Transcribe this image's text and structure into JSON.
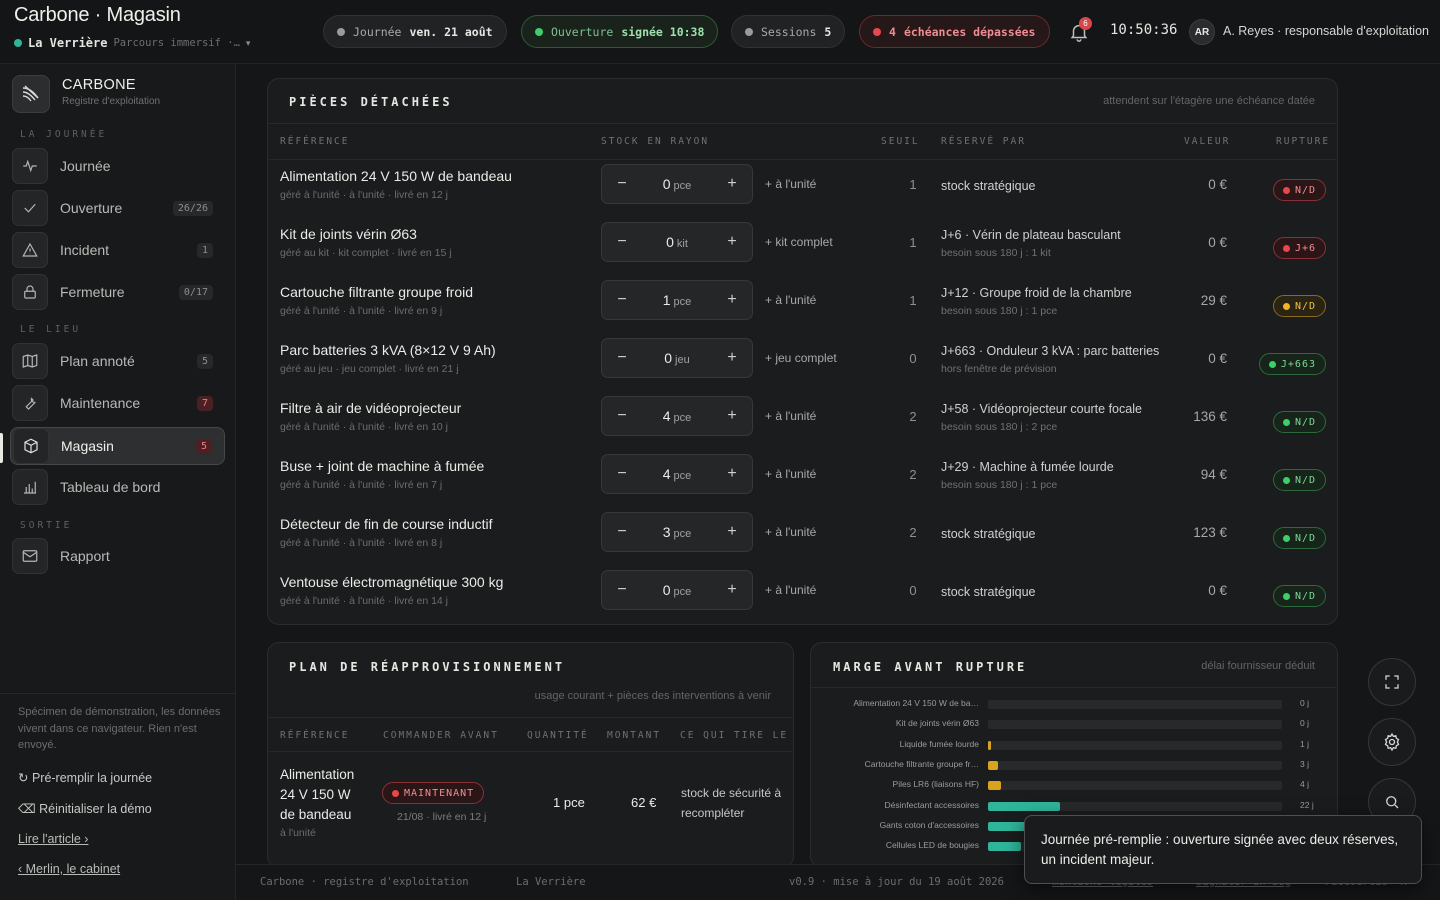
{
  "header": {
    "title": "Carbone · Magasin",
    "venue": "La Verrière",
    "mode": "Parcours immersif ·…",
    "day_label": "Journée",
    "day_value": "ven. 21 août",
    "open_label": "Ouverture",
    "open_value": "signée 10:38",
    "sessions_label": "Sessions",
    "sessions_value": "5",
    "due_count": "4",
    "due_label": "échéances dépassées",
    "notifications": "6",
    "clock": "10:50:36",
    "user_initials": "AR",
    "user_name": "A. Reyes · responsable d'exploitation",
    "colors": {
      "ok": "#3ecf6a",
      "alert": "#e5484d",
      "warn": "#f0b429",
      "accent": "#2fb59a"
    }
  },
  "sidebar": {
    "brand": "CARBONE",
    "brand_sub": "Registre d'exploitation",
    "sections": [
      "LA JOURNÉE",
      "LE LIEU",
      "SORTIE"
    ],
    "items": [
      {
        "label": "Journée",
        "icon": "pulse-icon",
        "count": ""
      },
      {
        "label": "Ouverture",
        "icon": "check-icon",
        "count": "26/26"
      },
      {
        "label": "Incident",
        "icon": "warning-icon",
        "count": "1"
      },
      {
        "label": "Fermeture",
        "icon": "lock-icon",
        "count": "0/17"
      },
      {
        "label": "Plan annoté",
        "icon": "map-icon",
        "count": "5"
      },
      {
        "label": "Maintenance",
        "icon": "wrench-icon",
        "count": "7"
      },
      {
        "label": "Magasin",
        "icon": "box-icon",
        "count": "5"
      },
      {
        "label": "Tableau de bord",
        "icon": "chart-icon",
        "count": ""
      },
      {
        "label": "Rapport",
        "icon": "mail-icon",
        "count": ""
      }
    ],
    "demo_note": "Spécimen de démonstration, les données vivent dans ce navigateur. Rien n'est envoyé.",
    "prefill": "↻ Pré-remplir la journée",
    "reset": "⌫ Réinitialiser la démo",
    "article": "Lire l'article ›",
    "cabinet": "‹ Merlin, le cabinet"
  },
  "parts": {
    "title": "PIÈCES DÉTACHÉES",
    "subtitle": "attendent sur l'étagère une échéance datée",
    "columns": [
      "RÉFÉRENCE",
      "STOCK EN RAYON",
      "SEUIL",
      "RÉSERVÉ PAR",
      "VALEUR",
      "RUPTURE"
    ],
    "rows": [
      {
        "name": "Alimentation 24 V 150 W de bandeau",
        "sub": "géré à l'unité · à l'unité · livré en 12 j",
        "qty": "0",
        "unit": "pce",
        "step": "+ à l'unité",
        "seuil": "1",
        "reserved": "stock stratégique",
        "reserved_sub": "",
        "value": "0 €",
        "status": "N/D",
        "tone": "red"
      },
      {
        "name": "Kit de joints vérin Ø63",
        "sub": "géré au kit · kit complet · livré en 15 j",
        "qty": "0",
        "unit": "kit",
        "step": "+ kit complet",
        "seuil": "1",
        "reserved": "J+6 · Vérin de plateau basculant",
        "reserved_sub": "besoin sous 180 j : 1 kit",
        "value": "0 €",
        "status": "J+6",
        "tone": "red"
      },
      {
        "name": "Cartouche filtrante groupe froid",
        "sub": "géré à l'unité · à l'unité · livré en 9 j",
        "qty": "1",
        "unit": "pce",
        "step": "+ à l'unité",
        "seuil": "1",
        "reserved": "J+12 · Groupe froid de la chambre",
        "reserved_sub": "besoin sous 180 j : 1 pce",
        "value": "29 €",
        "status": "N/D",
        "tone": "amber"
      },
      {
        "name": "Parc batteries 3 kVA (8×12 V 9 Ah)",
        "sub": "géré au jeu · jeu complet · livré en 21 j",
        "qty": "0",
        "unit": "jeu",
        "step": "+ jeu complet",
        "seuil": "0",
        "reserved": "J+663 · Onduleur 3 kVA : parc batteries",
        "reserved_sub": "hors fenêtre de prévision",
        "value": "0 €",
        "status": "J+663",
        "tone": "green"
      },
      {
        "name": "Filtre à air de vidéoprojecteur",
        "sub": "géré à l'unité · à l'unité · livré en 10 j",
        "qty": "4",
        "unit": "pce",
        "step": "+ à l'unité",
        "seuil": "2",
        "reserved": "J+58 · Vidéoprojecteur courte focale",
        "reserved_sub": "besoin sous 180 j : 2 pce",
        "value": "136 €",
        "status": "N/D",
        "tone": "green"
      },
      {
        "name": "Buse + joint de machine à fumée",
        "sub": "géré à l'unité · à l'unité · livré en 7 j",
        "qty": "4",
        "unit": "pce",
        "step": "+ à l'unité",
        "seuil": "2",
        "reserved": "J+29 · Machine à fumée lourde",
        "reserved_sub": "besoin sous 180 j : 1 pce",
        "value": "94 €",
        "status": "N/D",
        "tone": "green"
      },
      {
        "name": "Détecteur de fin de course inductif",
        "sub": "géré à l'unité · à l'unité · livré en 8 j",
        "qty": "3",
        "unit": "pce",
        "step": "+ à l'unité",
        "seuil": "2",
        "reserved": "stock stratégique",
        "reserved_sub": "",
        "value": "123 €",
        "status": "N/D",
        "tone": "green"
      },
      {
        "name": "Ventouse électromagnétique 300 kg",
        "sub": "géré à l'unité · à l'unité · livré en 14 j",
        "qty": "0",
        "unit": "pce",
        "step": "+ à l'unité",
        "seuil": "0",
        "reserved": "stock stratégique",
        "reserved_sub": "",
        "value": "0 €",
        "status": "N/D",
        "tone": "green"
      }
    ]
  },
  "plan": {
    "title": "PLAN DE RÉAPPROVISIONNEMENT",
    "subtitle": "usage courant + pièces des interventions à venir",
    "columns": [
      "RÉFÉRENCE",
      "COMMANDER AVANT",
      "QUANTITÉ",
      "MONTANT",
      "CE QUI TIRE LE S"
    ],
    "row": {
      "name_line1": "Alimentation",
      "name_line2": "24 V 150 W",
      "name_line3": "de bandeau",
      "sub": "à l'unité",
      "badge": "MAINTENANT",
      "date": "21/08 · livré en 12 j",
      "qty": "1 pce",
      "amount": "62 €",
      "reason_line1": "stock de sécurité à",
      "reason_line2": "recompléter"
    }
  },
  "margin_chart_header": {
    "title": "MARGE AVANT RUPTURE",
    "subtitle": "délai fournisseur déduit"
  },
  "chart_data": {
    "type": "bar",
    "orientation": "horizontal",
    "title": "MARGE AVANT RUPTURE",
    "subtitle": "délai fournisseur déduit",
    "categories": [
      "Alimentation 24 V 150 W de ba…",
      "Kit de joints vérin Ø63",
      "Liquide fumée lourde",
      "Cartouche filtrante groupe fr…",
      "Piles LR6 (liaisons HF)",
      "Désinfectant accessoires",
      "Gants coton d'accessoires",
      "Cellules LED de bougies"
    ],
    "values": [
      0,
      0,
      1,
      3,
      4,
      22,
      12,
      10
    ],
    "value_labels": [
      "0 j",
      "0 j",
      "1 j",
      "3 j",
      "4 j",
      "22 j",
      "",
      ""
    ],
    "colors": [
      "#e5484d",
      "#e5484d",
      "#d9a321",
      "#d9a321",
      "#d9a321",
      "#2fb59a",
      "#2fb59a",
      "#2fb59a"
    ],
    "xlim": [
      0,
      90
    ],
    "unit": "j"
  },
  "footer": {
    "left": "Carbone · registre d'exploitation",
    "venue": "La Verrière",
    "version": "v0.9 · mise à jour du 19 août 2026",
    "legal": "mentions légales",
    "bug": "signaler un bug",
    "shortcuts": "• raccourcis ⌘K"
  },
  "toast": {
    "text": "Journée pré-remplie : ouverture signée avec deux réserves, un incident majeur."
  }
}
